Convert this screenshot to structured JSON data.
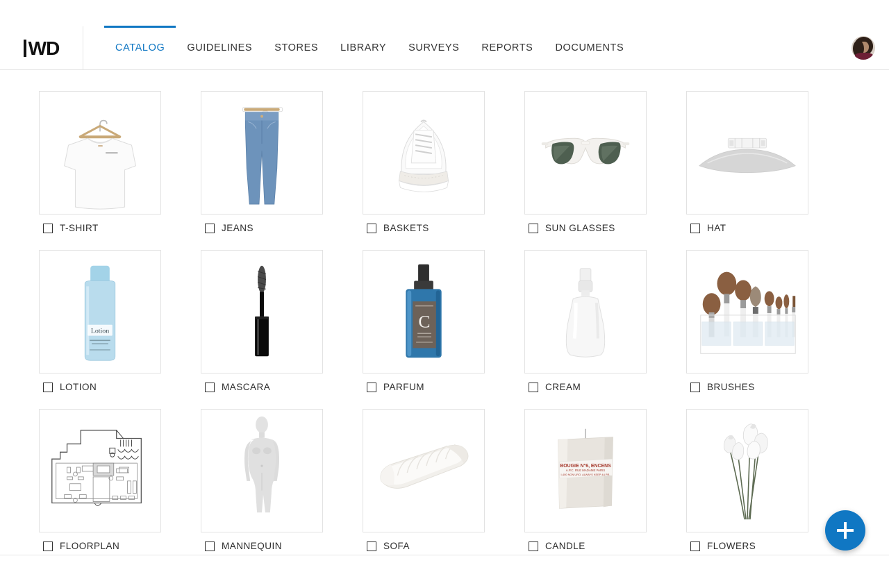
{
  "brand": {
    "logo_text": "IWD"
  },
  "header": {
    "nav": [
      {
        "label": "CATALOG",
        "active": true
      },
      {
        "label": "GUIDELINES",
        "active": false
      },
      {
        "label": "STORES",
        "active": false
      },
      {
        "label": "LIBRARY",
        "active": false
      },
      {
        "label": "SURVEYS",
        "active": false
      },
      {
        "label": "REPORTS",
        "active": false
      },
      {
        "label": "DOCUMENTS",
        "active": false
      }
    ],
    "avatar_name": "user-avatar",
    "accent_color": "#1077c3"
  },
  "catalog": {
    "items": [
      {
        "label": "T-SHIRT",
        "icon": "tshirt-on-hanger",
        "checked": false
      },
      {
        "label": "JEANS",
        "icon": "jeans-on-hanger",
        "checked": false
      },
      {
        "label": "BASKETS",
        "icon": "white-sneaker",
        "checked": false
      },
      {
        "label": "SUN GLASSES",
        "icon": "sunglasses",
        "checked": false
      },
      {
        "label": "HAT",
        "icon": "white-cap",
        "checked": false
      },
      {
        "label": "LOTION",
        "icon": "lotion-bottle",
        "checked": false
      },
      {
        "label": "MASCARA",
        "icon": "mascara-wand",
        "checked": false
      },
      {
        "label": "PARFUM",
        "icon": "perfume-bottle",
        "checked": false
      },
      {
        "label": "CREAM",
        "icon": "spray-bottle",
        "checked": false
      },
      {
        "label": "BRUSHES",
        "icon": "makeup-brushes",
        "checked": false
      },
      {
        "label": "FLOORPLAN",
        "icon": "floorplan-drawing",
        "checked": false
      },
      {
        "label": "MANNEQUIN",
        "icon": "mannequin",
        "checked": false
      },
      {
        "label": "SOFA",
        "icon": "white-sofa",
        "checked": false
      },
      {
        "label": "CANDLE",
        "icon": "scented-candle",
        "checked": false
      },
      {
        "label": "FLOWERS",
        "icon": "white-tulips",
        "checked": false
      }
    ],
    "product_text": {
      "lotion_label": "Lotion",
      "parfum_monogram": "C",
      "candle_line1": "BOUGIE N°6, ENCENS",
      "candle_line2": "A.P.C. RUE MADAME PARIS",
      "candle_line3": "I-400 NON URO. ALWAYS KEEP 44 PR."
    }
  },
  "fab": {
    "label": "+",
    "name": "add-item-button",
    "color": "#1077c3"
  }
}
